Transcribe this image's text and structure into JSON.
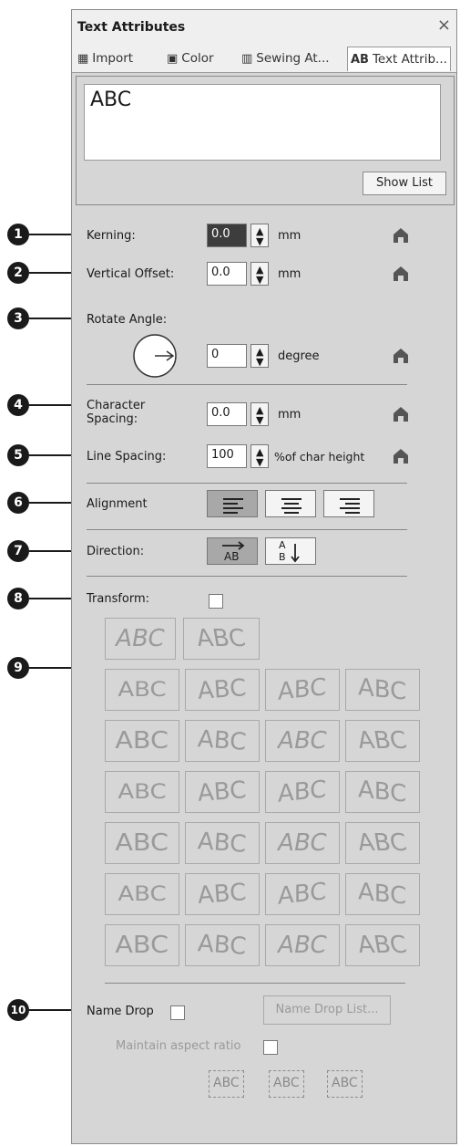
{
  "window": {
    "title": "Text Attributes",
    "close": "×"
  },
  "tabs": [
    {
      "label": "Import",
      "icon": "import-icon"
    },
    {
      "label": "Color",
      "icon": "spool-icon"
    },
    {
      "label": "Sewing At...",
      "icon": "stitch-icon"
    },
    {
      "label": "Text Attrib...",
      "icon_text": "AB",
      "active": true
    }
  ],
  "preview": {
    "text": "ABC"
  },
  "show_list_label": "Show List",
  "kerning": {
    "label": "Kerning:",
    "value": "0.0",
    "unit": "mm"
  },
  "vertical_offset": {
    "label": "Vertical Offset:",
    "value": "0.0",
    "unit": "mm"
  },
  "rotate": {
    "label": "Rotate Angle:",
    "value": "0",
    "unit": "degree"
  },
  "char_spacing": {
    "label": "Character Spacing:",
    "value": "0.0",
    "unit": "mm"
  },
  "line_spacing": {
    "label": "Line Spacing:",
    "value": "100",
    "unit": "%of char height"
  },
  "alignment": {
    "label": "Alignment",
    "options": [
      "left",
      "center",
      "right"
    ],
    "selected": "left"
  },
  "direction": {
    "label": "Direction:",
    "horizontal_text": "AB",
    "vertical_text": "A B"
  },
  "transform": {
    "label": "Transform:",
    "checked": false,
    "tile_text": "ABC"
  },
  "name_drop": {
    "label": "Name Drop",
    "checked": false,
    "list_button": "Name Drop List...",
    "aspect_label": "Maintain aspect ratio",
    "aspect_checked": false,
    "tiles": [
      "ABC",
      "ABC",
      "ABC"
    ]
  },
  "callouts": [
    "1",
    "2",
    "3",
    "4",
    "5",
    "6",
    "7",
    "8",
    "9",
    "10"
  ]
}
